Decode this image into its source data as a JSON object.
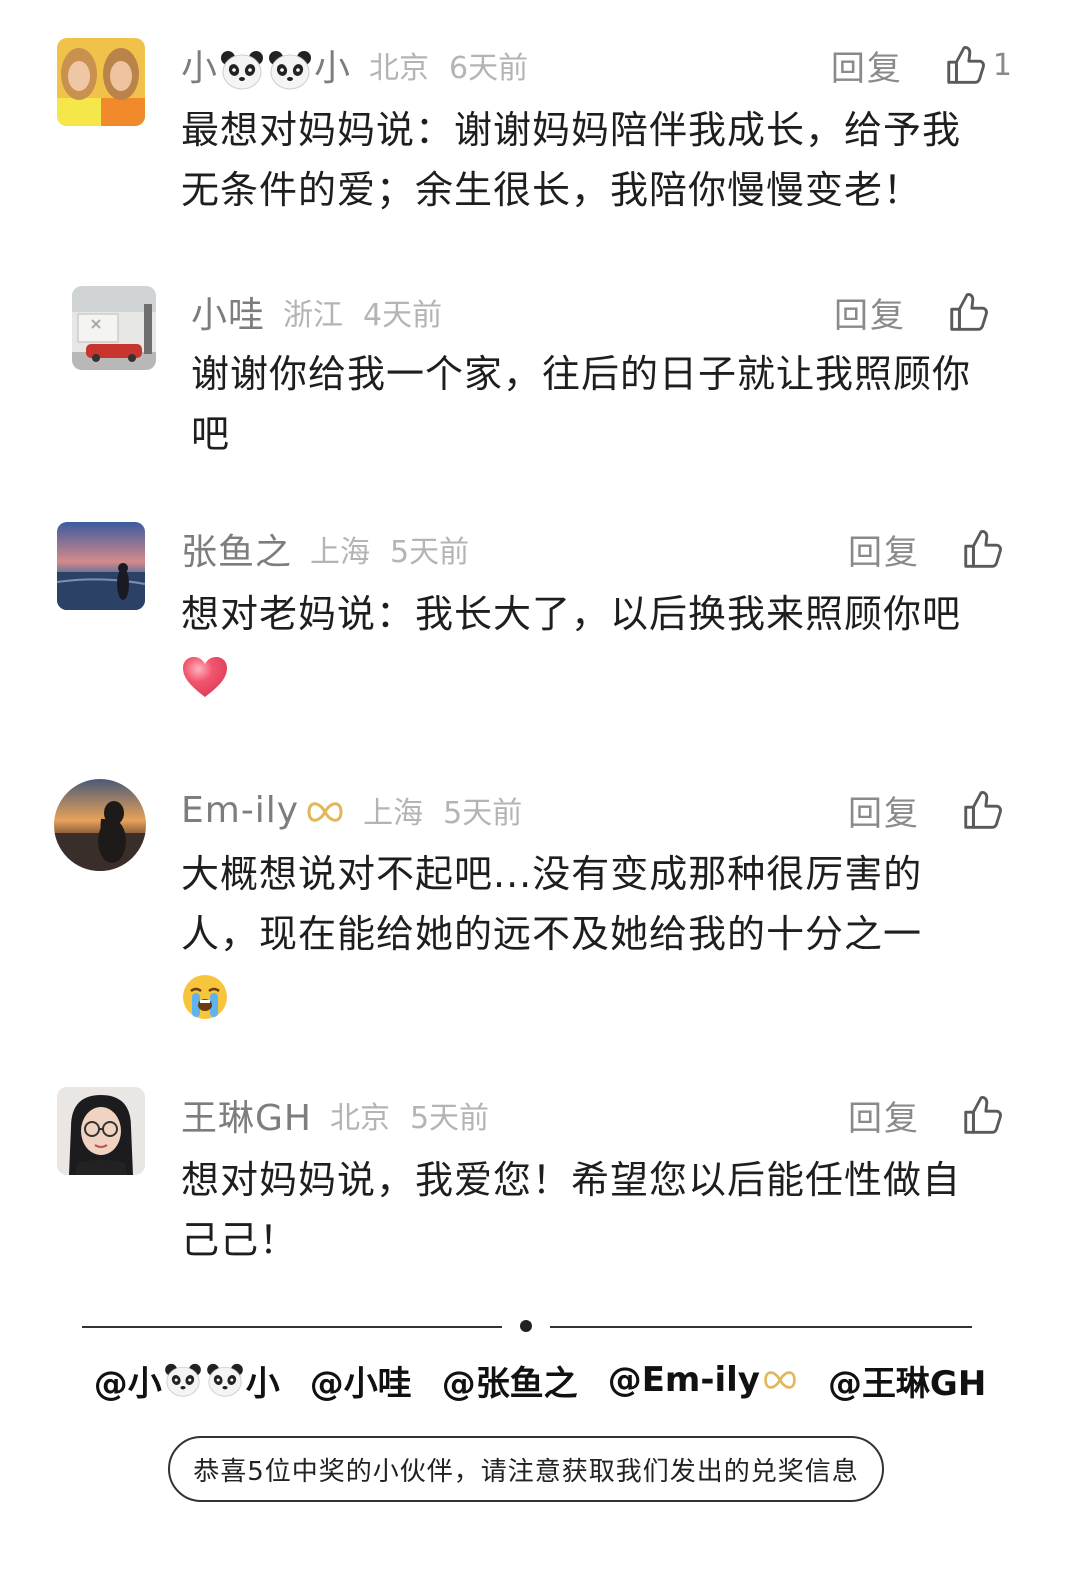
{
  "comments": [
    {
      "username_parts": [
        "小",
        "小"
      ],
      "region": "北京",
      "time": "6天前",
      "reply": "回复",
      "likes": "1",
      "lines": [
        "最想对妈妈说：谢谢妈妈陪伴我成长，给予我",
        "无条件的爱；余生很长，我陪你慢慢变老！"
      ]
    },
    {
      "username": "小哇",
      "region": "浙江",
      "time": "4天前",
      "reply": "回复",
      "lines": [
        "谢谢你给我一个家，往后的日子就让我照顾你",
        "吧"
      ]
    },
    {
      "username": "张鱼之",
      "region": "上海",
      "time": "5天前",
      "reply": "回复",
      "lines": [
        "想对老妈说：我长大了，以后换我来照顾你吧"
      ],
      "emoji": "heart-emoji"
    },
    {
      "username": "Em-ily",
      "region": "上海",
      "time": "5天前",
      "reply": "回复",
      "lines": [
        "大概想说对不起吧...没有变成那种很厉害的",
        "人，现在能给她的远不及她给我的十分之一"
      ],
      "emoji": "crying-face-emoji"
    },
    {
      "username": "王琳GH",
      "region": "北京",
      "time": "5天前",
      "reply": "回复",
      "lines": [
        "想对妈妈说，我爱您！希望您以后能任性做自",
        "己己！"
      ]
    }
  ],
  "mentions": {
    "m1_a": "@小",
    "m1_b": "小",
    "m2": "@小哇",
    "m3": "@张鱼之",
    "m4": "@Em-ily",
    "m5": "@王琳GH"
  },
  "notice": "恭喜5位中奖的小伙伴，请注意获取我们发出的兑奖信息",
  "colors": {
    "username": "#7d7d7d",
    "meta": "#b4b4b4",
    "body": "#1e1e1e",
    "infinity": "#e0b85a",
    "heart": "#f2566e"
  }
}
